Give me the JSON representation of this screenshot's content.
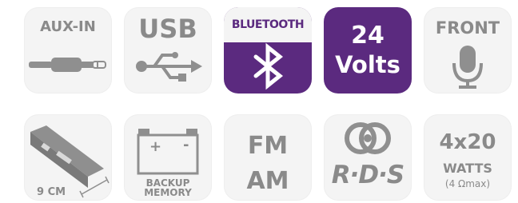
{
  "colors": {
    "tile_bg": "#f4f4f4",
    "text_gray": "#8a8a8a",
    "icon_gray": "#8f8f8f",
    "purple": "#5b2a7f",
    "white": "#ffffff"
  },
  "row1": {
    "aux": {
      "label": "AUX-IN",
      "icon": "aux-cable-icon"
    },
    "usb": {
      "label": "USB",
      "icon": "usb-icon"
    },
    "bluetooth": {
      "label": "BLUETOOTH",
      "icon": "bluetooth-icon"
    },
    "volts": {
      "line1": "24",
      "line2": "Volts"
    },
    "front": {
      "label": "FRONT",
      "icon": "microphone-icon"
    }
  },
  "row2": {
    "din": {
      "label": "9 CM",
      "icon": "radio-unit-icon"
    },
    "backup": {
      "line1": "BACKUP",
      "line2": "MEMORY",
      "plus": "+",
      "minus": "-",
      "icon": "battery-icon"
    },
    "fmam": {
      "line1": "FM",
      "line2": "AM"
    },
    "rds": {
      "label": "R·D·S",
      "icon": "rds-logo-icon"
    },
    "watts": {
      "line1": "4x20",
      "line2": "WATTS",
      "line3": "(4 Ωmax)"
    }
  }
}
